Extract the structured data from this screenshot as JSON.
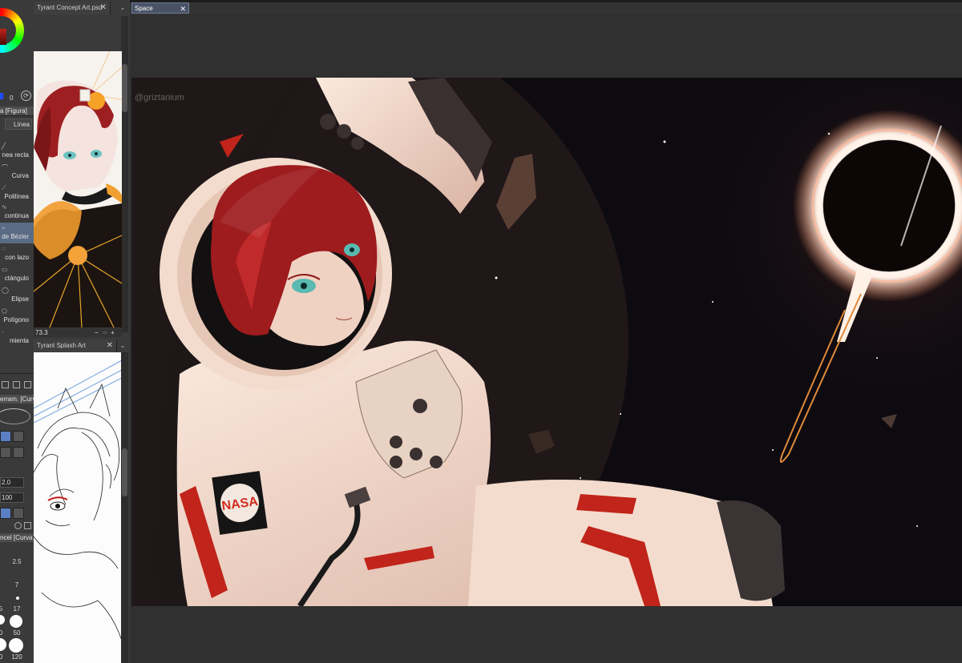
{
  "colors": {
    "toolbar_bg": "#3a3a3a",
    "canvas_bg": "#303030",
    "active_tab": "#4a5366",
    "active_tool": "#5a6b86",
    "suit": "#f0d9cc",
    "hair": "#a11a1c",
    "visor_dark": "#111",
    "black_hole_glow": "#ffe0cf"
  },
  "color_panel": {
    "hue_value": "0"
  },
  "subtool_panel": {
    "title": "a [Figura]",
    "lines_button": "Línea",
    "items": [
      {
        "label": "nea recta"
      },
      {
        "label": "Curva"
      },
      {
        "label": "Polilínea"
      },
      {
        "label": "continua"
      },
      {
        "label": "de Bézier"
      },
      {
        "label": "con lazo"
      },
      {
        "label": "ctángulo"
      },
      {
        "label": "Elipse"
      },
      {
        "label": "Polígono"
      },
      {
        "label": "mienta"
      }
    ]
  },
  "tool_property": {
    "title": "erram. [Curv",
    "values": [
      "2.0",
      "100"
    ]
  },
  "brush_size": {
    "title": "ncel [Curva d",
    "sizes": [
      "2.5",
      "7",
      "5",
      "17",
      "0",
      "50",
      "0",
      "120"
    ]
  },
  "navigator": {
    "zoom": "73.3",
    "documents": [
      {
        "name": "Tyrant Concept Art.psd",
        "close": "✕"
      },
      {
        "name": "Tyrant Splash Art",
        "close": "✕"
      }
    ]
  },
  "canvas": {
    "tab": "Space",
    "close": "✕",
    "signature": "@griztanium",
    "patch_text": "NASA"
  }
}
